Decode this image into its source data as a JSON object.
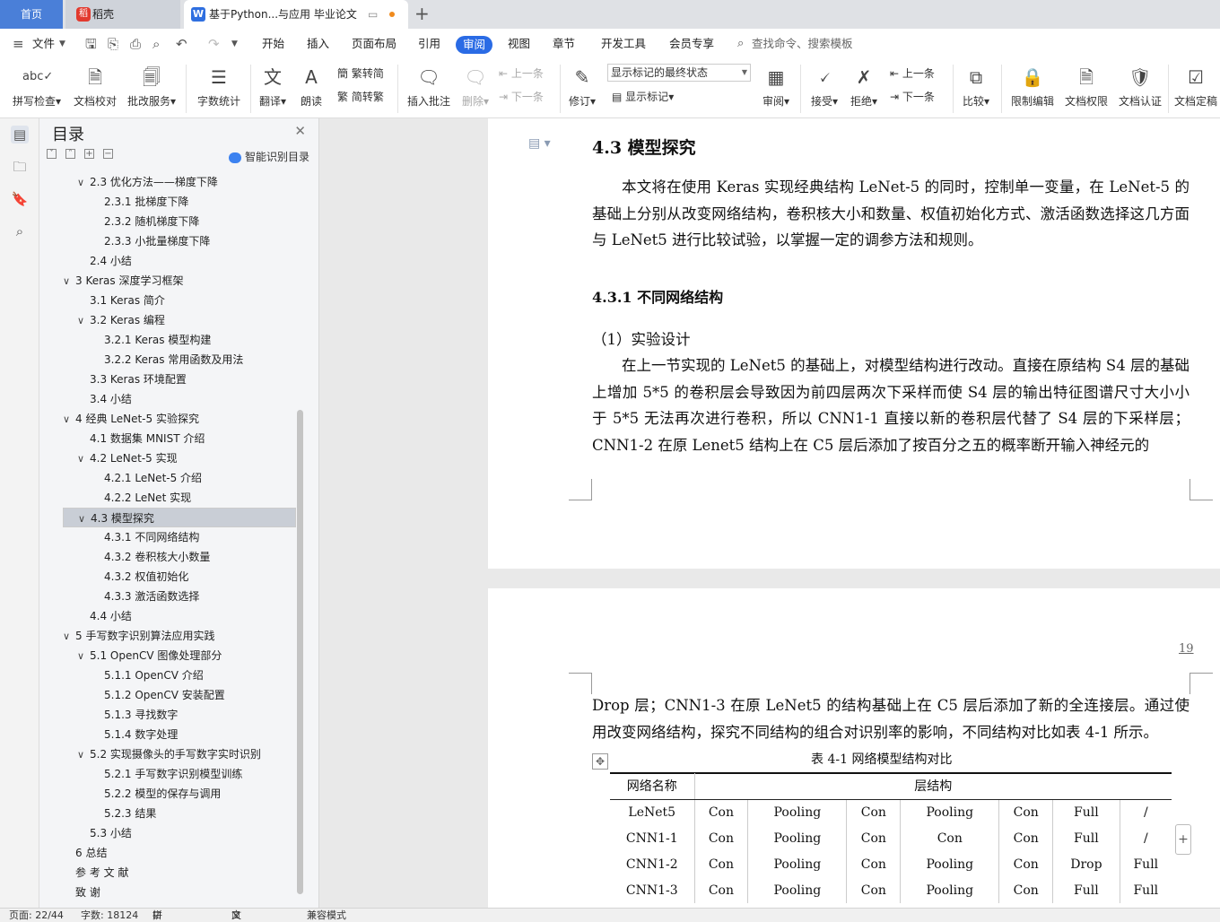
{
  "tabs": {
    "home": "首页",
    "daoke": "稻壳",
    "doc": "基于Python...与应用 毕业论文",
    "add": "+"
  },
  "menu": {
    "file": "文件",
    "items": [
      "开始",
      "插入",
      "页面布局",
      "引用",
      "审阅",
      "视图",
      "章节",
      "开发工具",
      "会员专享"
    ],
    "active": "审阅",
    "search": "查找命令、搜索模板"
  },
  "ribbon": {
    "spell": "拼写检查",
    "proof": "文档校对",
    "revise_service": "批改服务",
    "word_count": "字数统计",
    "translate": "翻译",
    "read": "朗读",
    "trad": "繁转简",
    "simp": "简转繁",
    "insert_comment": "插入批注",
    "delete": "删除",
    "prev_comment": "上一条",
    "next_comment": "下一条",
    "revise": "修订",
    "markup_state": "显示标记的最终状态",
    "show_markup": "显示标记",
    "review": "审阅",
    "accept": "接受",
    "reject": "拒绝",
    "prev_change": "上一条",
    "next_change": "下一条",
    "compare": "比较",
    "restrict": "限制编辑",
    "permission": "文档权限",
    "certify": "文档认证",
    "finalize": "文档定稿"
  },
  "toc": {
    "title": "目录",
    "smart": "智能识别目录",
    "items": [
      {
        "level": 2,
        "text": "2.3  优化方法——梯度下降",
        "expand": true
      },
      {
        "level": 3,
        "text": "2.3.1  批梯度下降"
      },
      {
        "level": 3,
        "text": "2.3.2  随机梯度下降"
      },
      {
        "level": 3,
        "text": "2.3.3  小批量梯度下降"
      },
      {
        "level": 2,
        "text": "2.4  小结"
      },
      {
        "level": 1,
        "text": "3 Keras 深度学习框架",
        "expand": true
      },
      {
        "level": 2,
        "text": "3.1 Keras 简介"
      },
      {
        "level": 2,
        "text": "3.2 Keras 编程",
        "expand": true
      },
      {
        "level": 3,
        "text": "3.2.1 Keras 模型构建"
      },
      {
        "level": 3,
        "text": "3.2.2 Keras 常用函数及用法"
      },
      {
        "level": 2,
        "text": "3.3 Keras 环境配置"
      },
      {
        "level": 2,
        "text": "3.4  小结"
      },
      {
        "level": 1,
        "text": "4  经典 LeNet-5 实验探究",
        "expand": true
      },
      {
        "level": 2,
        "text": "4.1  数据集 MNIST 介绍"
      },
      {
        "level": 2,
        "text": "4.2 LeNet-5 实现",
        "expand": true
      },
      {
        "level": 3,
        "text": "4.2.1 LeNet-5 介绍"
      },
      {
        "level": 3,
        "text": "4.2.2 LeNet 实现"
      },
      {
        "level": 2,
        "text": "4.3  模型探究",
        "expand": true,
        "selected": true
      },
      {
        "level": 3,
        "text": "4.3.1  不同网络结构"
      },
      {
        "level": 3,
        "text": "4.3.2  卷积核大小数量"
      },
      {
        "level": 3,
        "text": "4.3.2  权值初始化"
      },
      {
        "level": 3,
        "text": "4.3.3  激活函数选择"
      },
      {
        "level": 2,
        "text": "4.4  小结"
      },
      {
        "level": 1,
        "text": "5  手写数字识别算法应用实践",
        "expand": true
      },
      {
        "level": 2,
        "text": "5.1 OpenCV 图像处理部分",
        "expand": true
      },
      {
        "level": 3,
        "text": "5.1.1 OpenCV 介绍"
      },
      {
        "level": 3,
        "text": "5.1.2 OpenCV 安装配置"
      },
      {
        "level": 3,
        "text": "5.1.3  寻找数字"
      },
      {
        "level": 3,
        "text": "5.1.4  数字处理"
      },
      {
        "level": 2,
        "text": "5.2  实现摄像头的手写数字实时识别",
        "expand": true
      },
      {
        "level": 3,
        "text": "5.2.1  手写数字识别模型训练"
      },
      {
        "level": 3,
        "text": "5.2.2  模型的保存与调用"
      },
      {
        "level": 3,
        "text": "5.2.3  结果"
      },
      {
        "level": 2,
        "text": "5.3 小结"
      },
      {
        "level": 1,
        "text": "6  总结"
      },
      {
        "level": 1,
        "text": "参 考 文 献"
      },
      {
        "level": 1,
        "text": "致  谢"
      }
    ]
  },
  "doc": {
    "heading": "4.3  模型探究",
    "intro": "本文将在使用 Keras 实现经典结构 LeNet-5 的同时，控制单一变量，在 LeNet-5 的基础上分别从改变网络结构，卷积核大小和数量、权值初始化方式、激活函数选择这几方面与 LeNet5 进行比较试验，以掌握一定的调参方法和规则。",
    "subheading": "4.3.1  不同网络结构",
    "exp_title": "（1）实验设计",
    "exp_text": "在上一节实现的 LeNet5 的基础上，对模型结构进行改动。直接在原结构 S4 层的基础上增加 5*5 的卷积层会导致因为前四层两次下采样而使 S4 层的输出特征图谱尺寸大小小于 5*5 无法再次进行卷积，所以 CNN1-1 直接以新的卷积层代替了 S4 层的下采样层；CNN1-2 在原 Lenet5 结构上在 C5 层后添加了按百分之五的概率断开输入神经元的",
    "page_number": "19",
    "p2_text": "Drop 层；CNN1-3 在原 LeNet5 的结构基础上在 C5 层后添加了新的全连接层。通过使用改变网络结构，探究不同结构的组合对识别率的影响，不同结构对比如表 4-1 所示。",
    "table_caption": "表 4-1  网络模型结构对比",
    "table_header": [
      "网络名称",
      "层结构"
    ],
    "table_rows": [
      [
        "LeNet5",
        "Con",
        "Pooling",
        "Con",
        "Pooling",
        "Con",
        "Full",
        "/"
      ],
      [
        "CNN1-1",
        "Con",
        "Pooling",
        "Con",
        "Con",
        "Con",
        "Full",
        "/"
      ],
      [
        "CNN1-2",
        "Con",
        "Pooling",
        "Con",
        "Pooling",
        "Con",
        "Drop",
        "Full"
      ],
      [
        "CNN1-3",
        "Con",
        "Pooling",
        "Con",
        "Pooling",
        "Con",
        "Full",
        "Full"
      ]
    ]
  },
  "status": {
    "page": "页面: 22/44",
    "words": "字数: 18124",
    "spell": "拼写检查",
    "proof": "文档校对",
    "compat": "兼容模式"
  },
  "colors": {
    "accent": "#2a6be5",
    "home_tab": "#4a7fd8"
  }
}
